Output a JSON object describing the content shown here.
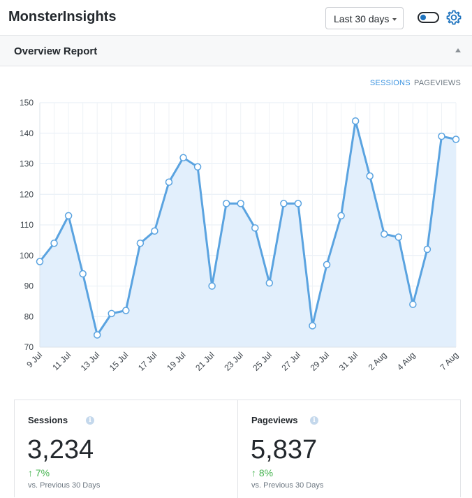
{
  "app": {
    "title": "MonsterInsights"
  },
  "header": {
    "date_range": "Last 30 days"
  },
  "report": {
    "title": "Overview Report",
    "tabs": [
      {
        "label": "SESSIONS",
        "active": true
      },
      {
        "label": "PAGEVIEWS",
        "active": false
      }
    ]
  },
  "colors": {
    "line": "#5aa3e0",
    "area": "#e2effc",
    "accent": "#3b93e0",
    "up": "#46b450"
  },
  "chart_data": {
    "type": "area",
    "series": [
      {
        "values": [
          98,
          104,
          113,
          94,
          74,
          81,
          82,
          104,
          108,
          124,
          132,
          129,
          90,
          117,
          117,
          109,
          91,
          117,
          117,
          77,
          97,
          113,
          144,
          126,
          107,
          106,
          84,
          102,
          139,
          138
        ]
      }
    ],
    "x_tick_labels": [
      "9 Jul",
      "11 Jul",
      "13 Jul",
      "15 Jul",
      "17 Jul",
      "19 Jul",
      "21 Jul",
      "23 Jul",
      "25 Jul",
      "27 Jul",
      "29 Jul",
      "31 Jul",
      "2 Aug",
      "4 Aug",
      "7 Aug"
    ],
    "x_tick_index": [
      0,
      2,
      4,
      6,
      8,
      10,
      12,
      14,
      16,
      18,
      20,
      22,
      24,
      26,
      29
    ],
    "y_ticks": [
      70,
      80,
      90,
      100,
      110,
      120,
      130,
      140,
      150
    ],
    "ylim": [
      70,
      150
    ],
    "grid": true
  },
  "stats": [
    {
      "label": "Sessions",
      "value": "3,234",
      "change": "7%",
      "sub": "vs. Previous 30 Days"
    },
    {
      "label": "Pageviews",
      "value": "5,837",
      "change": "8%",
      "sub": "vs. Previous 30 Days"
    }
  ]
}
